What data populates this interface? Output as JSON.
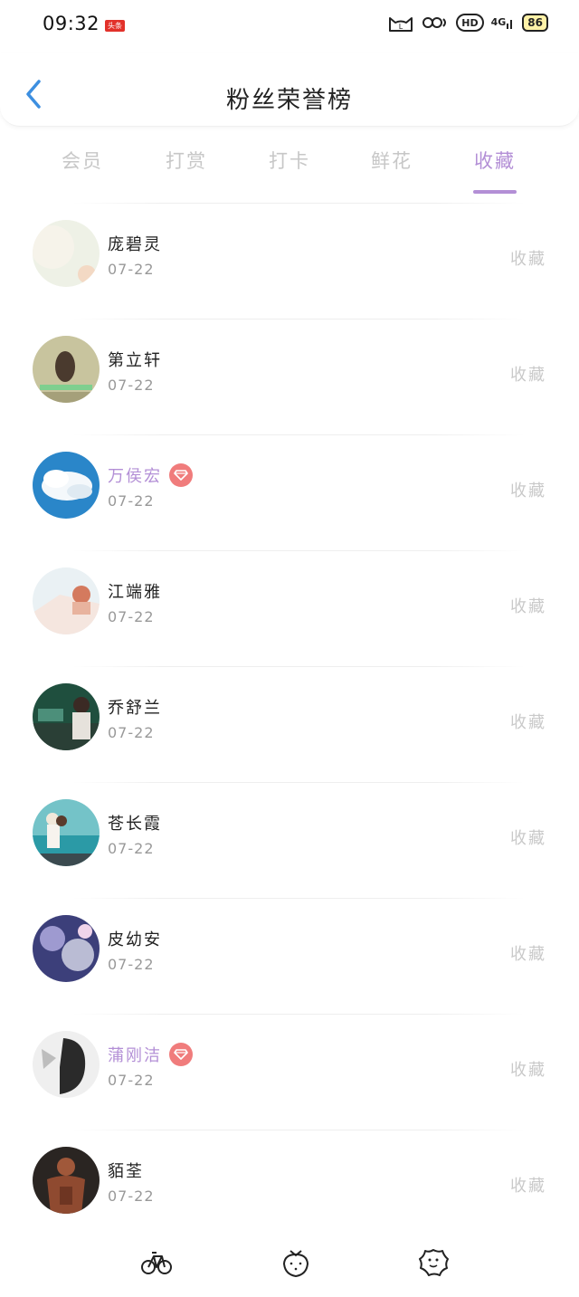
{
  "status_bar": {
    "time": "09:32",
    "news_badge": "头条",
    "hd_label": "HD",
    "network": "4G",
    "battery": "86"
  },
  "header": {
    "title": "粉丝荣誉榜",
    "back_icon": "chevron-left-icon"
  },
  "tabs": [
    {
      "label": "会员",
      "active": false
    },
    {
      "label": "打赏",
      "active": false
    },
    {
      "label": "打卡",
      "active": false
    },
    {
      "label": "鲜花",
      "active": false
    },
    {
      "label": "收藏",
      "active": true
    }
  ],
  "accent_color": "#b38fd6",
  "vip_badge_color": "#f07c7c",
  "list": [
    {
      "name": "庞碧灵",
      "date": "07-22",
      "action": "收藏",
      "vip": false
    },
    {
      "name": "第立轩",
      "date": "07-22",
      "action": "收藏",
      "vip": false
    },
    {
      "name": "万侯宏",
      "date": "07-22",
      "action": "收藏",
      "vip": true
    },
    {
      "name": "江端雅",
      "date": "07-22",
      "action": "收藏",
      "vip": false
    },
    {
      "name": "乔舒兰",
      "date": "07-22",
      "action": "收藏",
      "vip": false
    },
    {
      "name": "苍长霞",
      "date": "07-22",
      "action": "收藏",
      "vip": false
    },
    {
      "name": "皮幼安",
      "date": "07-22",
      "action": "收藏",
      "vip": false
    },
    {
      "name": "蒲刚洁",
      "date": "07-22",
      "action": "收藏",
      "vip": true
    },
    {
      "name": "貊荃",
      "date": "07-22",
      "action": "收藏",
      "vip": false
    }
  ],
  "bottom_bar": [
    {
      "icon": "bicycle-icon"
    },
    {
      "icon": "strawberry-icon"
    },
    {
      "icon": "cookie-icon"
    }
  ]
}
